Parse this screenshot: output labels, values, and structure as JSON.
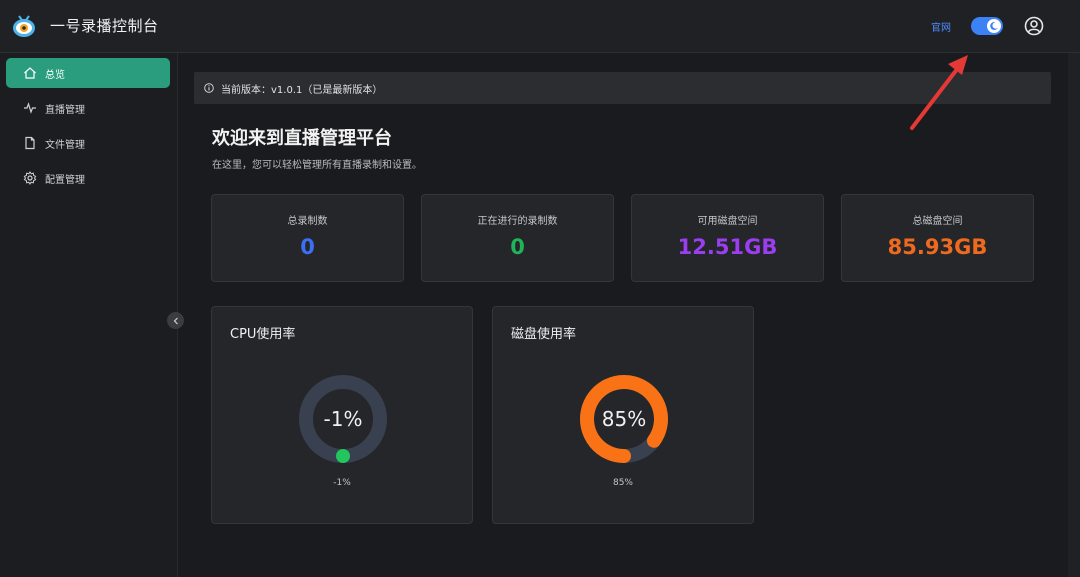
{
  "header": {
    "title": "一号录播控制台",
    "official_link": "官网",
    "theme_toggle_state": "dark"
  },
  "sidebar": {
    "items": [
      {
        "label": "总览",
        "icon": "home-icon",
        "active": true
      },
      {
        "label": "直播管理",
        "icon": "activity-icon",
        "active": false
      },
      {
        "label": "文件管理",
        "icon": "file-icon",
        "active": false
      },
      {
        "label": "配置管理",
        "icon": "settings-icon",
        "active": false
      }
    ]
  },
  "version_bar": {
    "text": "当前版本：v1.0.1（已是最新版本）"
  },
  "welcome": {
    "title": "欢迎来到直播管理平台",
    "subtitle": "在这里，您可以轻松管理所有直播录制和设置。"
  },
  "stats": [
    {
      "label": "总录制数",
      "value": "0",
      "color": "#3b6ff5"
    },
    {
      "label": "正在进行的录制数",
      "value": "0",
      "color": "#1fb35a"
    },
    {
      "label": "可用磁盘空间",
      "value": "12.51GB",
      "color": "#9b3ef0"
    },
    {
      "label": "总磁盘空间",
      "value": "85.93GB",
      "color": "#ef6a1f"
    }
  ],
  "gauges": [
    {
      "title": "CPU使用率",
      "center": "-1%",
      "sub": "-1%",
      "value": -1,
      "color": "#22c55e"
    },
    {
      "title": "磁盘使用率",
      "center": "85%",
      "sub": "85%",
      "value": 85,
      "color": "#f97316"
    }
  ]
}
